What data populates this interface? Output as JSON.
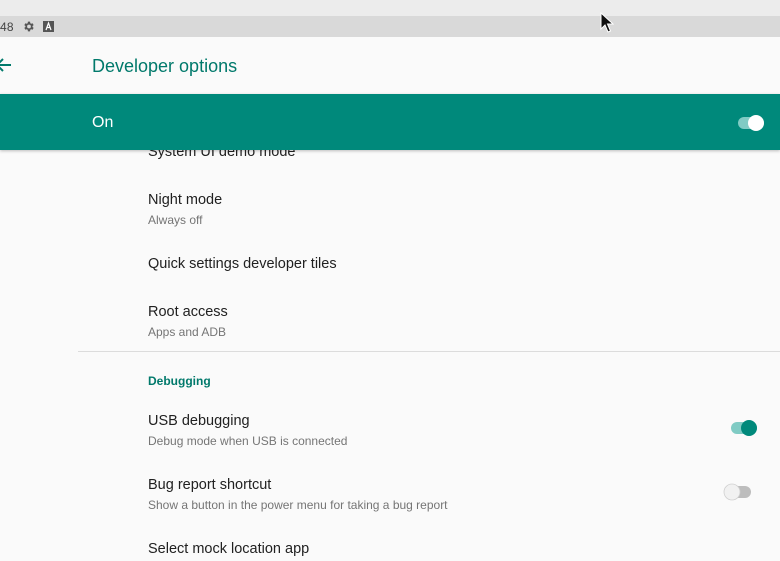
{
  "status_bar": {
    "time": "48",
    "icons": [
      "gear-icon",
      "a-box-icon"
    ]
  },
  "app_bar": {
    "title": "Developer options",
    "back_icon": "arrow-left-icon"
  },
  "master_switch": {
    "label": "On",
    "checked": true
  },
  "list": {
    "cut_item": "System UI demo mode",
    "items": [
      {
        "title": "Night mode",
        "summary": "Always off"
      },
      {
        "title": "Quick settings developer tiles"
      },
      {
        "title": "Root access",
        "summary": "Apps and ADB"
      }
    ],
    "section_header": "Debugging",
    "debug_items": [
      {
        "title": "USB debugging",
        "summary": "Debug mode when USB is connected",
        "checked": true
      },
      {
        "title": "Bug report shortcut",
        "summary": "Show a button in the power menu for taking a bug report",
        "checked": false
      },
      {
        "title": "Select mock location app"
      }
    ]
  },
  "colors": {
    "accent": "#00796b",
    "bar": "#00897b",
    "toggle_off": "#bdbdbd"
  }
}
